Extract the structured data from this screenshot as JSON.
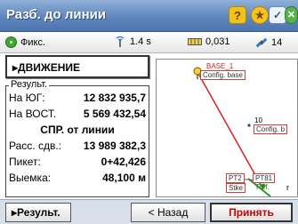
{
  "title": "Разб. до линии",
  "toolbar": {
    "help_glyph": "?",
    "star_glyph": "★",
    "edit_glyph": "✓",
    "close_glyph": "✕"
  },
  "status": {
    "fix_label": "Фикс.",
    "age_value": "1.4 s",
    "precision_value": "0,031",
    "satellites_value": "14"
  },
  "panel": {
    "movement_label": "▸ДВИЖЕНИЕ",
    "results_legend": "Результ.",
    "rows": [
      {
        "label": "На ЮГ:",
        "value": "12 832 935,7"
      },
      {
        "label": "На ВОСТ.",
        "value": "5 569 432,54"
      },
      {
        "center": "СПР. от линии"
      },
      {
        "label": "Расс. сдв.:",
        "value": "13 989 382,3"
      },
      {
        "label": "Пикет:",
        "value": "0+42,426"
      },
      {
        "label": "Выемка:",
        "value": "48,100 м"
      }
    ]
  },
  "map": {
    "base_label_1": "BASE_1",
    "base_label_2": "Config. base",
    "pt10_label_1": "10",
    "pt10_label_2": "Config. b",
    "pt2_label_1": "PT2",
    "pt2_label_2": "Stke",
    "pt81_label_1": "PT81",
    "pt81_label_2": "Ref.",
    "r_label": "r"
  },
  "buttons": {
    "results": "▸Результ.",
    "back": "< Назад",
    "accept": "Принять"
  },
  "colors": {
    "title_bar": "#5f86bd",
    "accept_text": "#cc0000",
    "line_red": "#e02020",
    "line_green": "#20a020"
  }
}
